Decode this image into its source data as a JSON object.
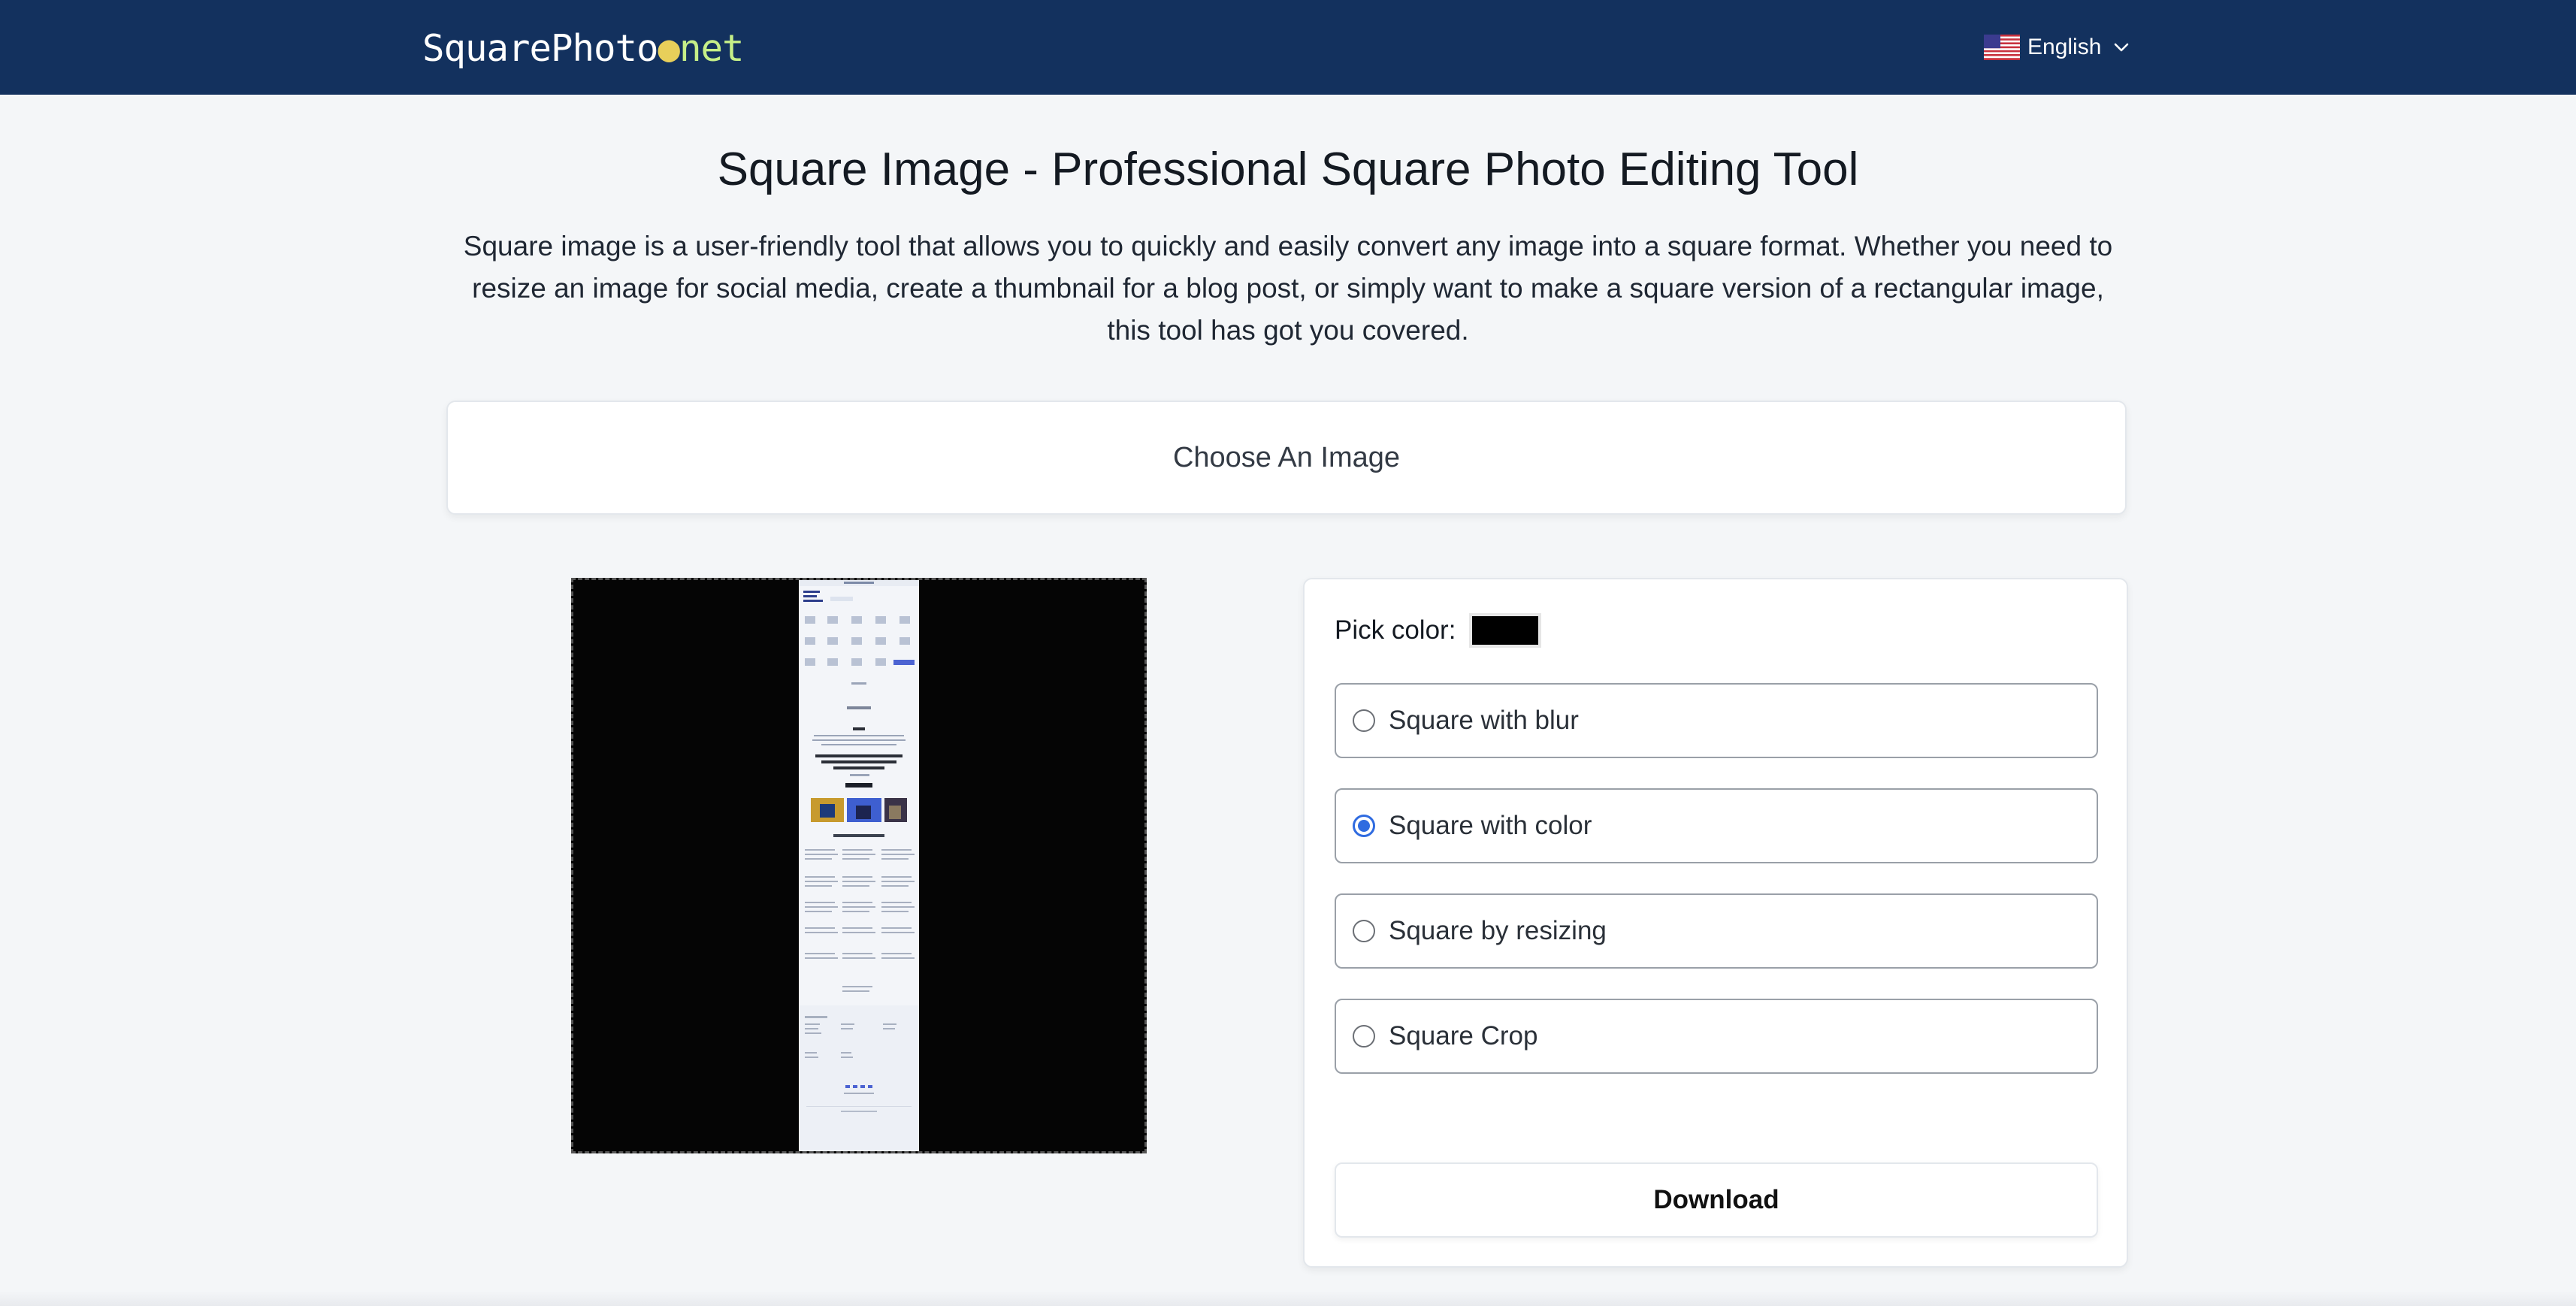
{
  "header": {
    "logo": {
      "name": "SquarePhoto",
      "dot": "●",
      "tld": "net"
    },
    "language": {
      "label": "English",
      "flag_icon": "us-flag-icon",
      "chevron_icon": "chevron-down-icon"
    }
  },
  "intro": {
    "title": "Square Image - Professional Square Photo Editing Tool",
    "description": "Square image is a user-friendly tool that allows you to quickly and easily convert any image into a square format. Whether you need to resize an image for social media, create a thumbnail for a blog post, or simply want to make a square version of a rectangular image, this tool has got you covered."
  },
  "upload": {
    "label": "Choose An Image"
  },
  "preview": {
    "background_color": "#050505"
  },
  "options": {
    "pick_color_label": "Pick color:",
    "picked_color": "#000000",
    "modes": [
      {
        "label": "Square with blur",
        "selected": false
      },
      {
        "label": "Square with color",
        "selected": true
      },
      {
        "label": "Square by resizing",
        "selected": false
      },
      {
        "label": "Square Crop",
        "selected": false
      }
    ],
    "download_label": "Download"
  },
  "colors": {
    "header_bg": "#13315e",
    "accent": "#2f6be0",
    "page_bg": "#f4f6f8"
  }
}
